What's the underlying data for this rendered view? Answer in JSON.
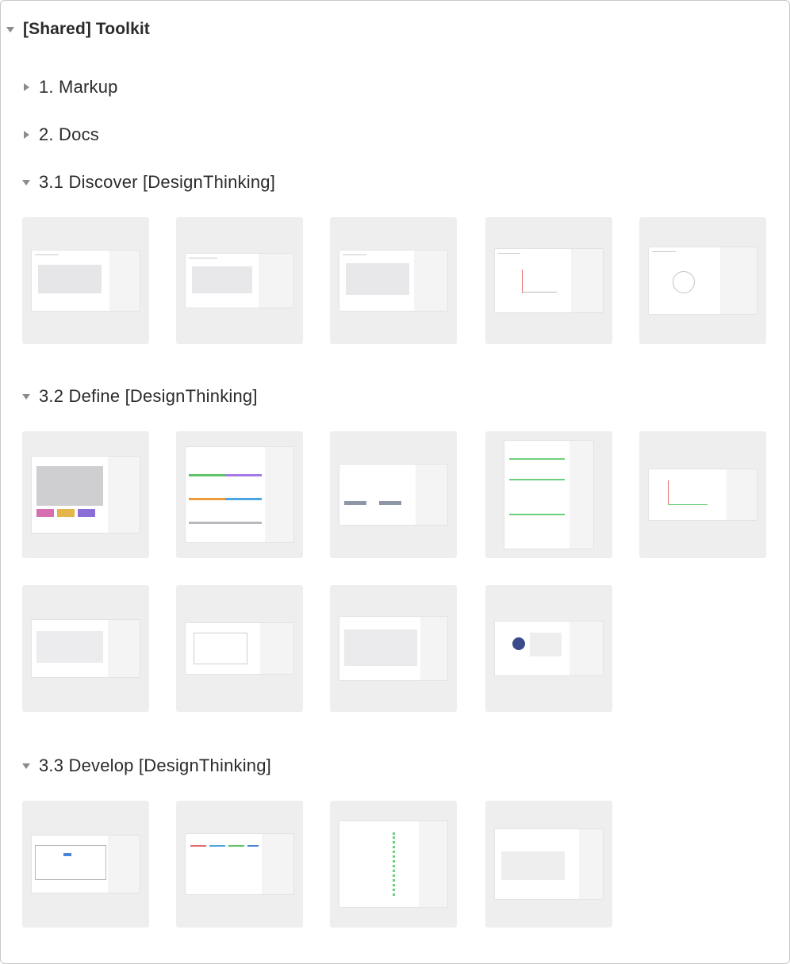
{
  "root": {
    "label": "[Shared] Toolkit",
    "expanded": true
  },
  "sections": [
    {
      "label": "1. Markup",
      "expanded": false
    },
    {
      "label": "2. Docs",
      "expanded": false
    },
    {
      "label": "3.1 Discover [DesignThinking]",
      "expanded": true,
      "thumbnail_count": 5
    },
    {
      "label": "3.2 Define [DesignThinking]",
      "expanded": true,
      "thumbnail_count": 9
    },
    {
      "label": "3.3 Develop [DesignThinking]",
      "expanded": true,
      "thumbnail_count": 4
    }
  ],
  "colors": {
    "tile_background": "#eeeeef",
    "chevron": "#8c8c8c",
    "text": "#2b2b2b",
    "border": "#c8c8c8"
  },
  "icons": {
    "expanded": "triangle-down-icon",
    "collapsed": "triangle-right-icon"
  }
}
